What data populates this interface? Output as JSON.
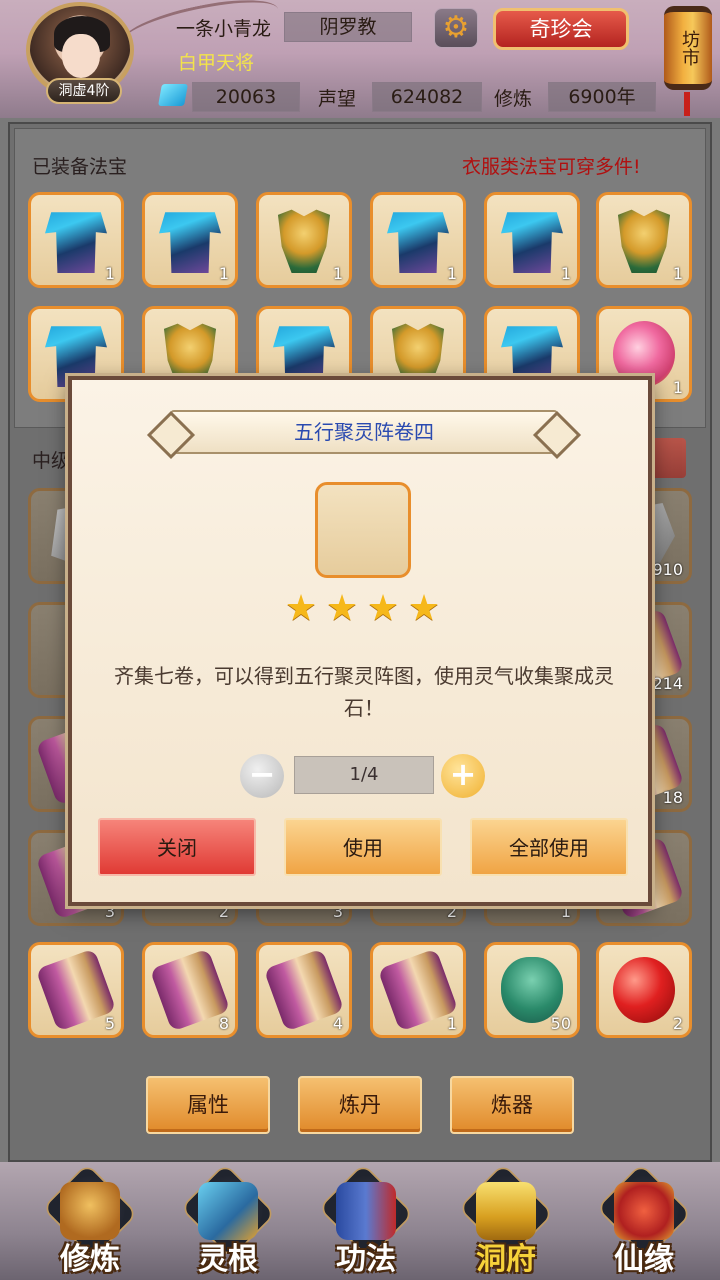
{
  "header": {
    "rank_badge": "洞虚4阶",
    "player_name": "一条小青龙",
    "sect": "阴罗教",
    "title": "白甲天将",
    "gems": "20063",
    "reputation_label": "声望",
    "reputation": "624082",
    "cultivation_label": "修炼",
    "cultivation": "6900年",
    "treasure_button": "奇珍会",
    "market_lantern": "坊市"
  },
  "equipped": {
    "label": "已装备法宝",
    "notice": "衣服类法宝可穿多件!",
    "items": [
      {
        "icon": "blue-robe-icon",
        "count": "1"
      },
      {
        "icon": "blue-robe-icon",
        "count": "1"
      },
      {
        "icon": "gold-armor-icon",
        "count": "1"
      },
      {
        "icon": "blue-robe-icon",
        "count": "1"
      },
      {
        "icon": "blue-robe-icon",
        "count": "1"
      },
      {
        "icon": "gold-armor-icon",
        "count": "1"
      },
      {
        "icon": "blue-robe-icon",
        "count": ""
      },
      {
        "icon": "gold-armor-icon",
        "count": ""
      },
      {
        "icon": "blue-robe-icon",
        "count": ""
      },
      {
        "icon": "gold-armor-icon",
        "count": ""
      },
      {
        "icon": "blue-robe-icon",
        "count": ""
      },
      {
        "icon": "pink-orb-icon",
        "count": "1"
      }
    ]
  },
  "inventory": {
    "label": "中级",
    "visible_counts": [
      "910",
      "214",
      "18",
      "3",
      "2",
      "3",
      "2",
      "1"
    ],
    "last_row": [
      {
        "icon": "scroll-icon",
        "count": "5"
      },
      {
        "icon": "scroll-icon",
        "count": "8"
      },
      {
        "icon": "scroll-icon",
        "count": "4"
      },
      {
        "icon": "scroll-icon",
        "count": "1"
      },
      {
        "icon": "gourd-icon",
        "count": "50"
      },
      {
        "icon": "red-orb-icon",
        "count": "2"
      }
    ]
  },
  "actions": {
    "attributes": "属性",
    "alchemy": "炼丹",
    "forging": "炼器"
  },
  "modal": {
    "title": "五行聚灵阵卷四",
    "item_icon": "scroll-icon",
    "stars": 4,
    "description": "齐集七卷，可以得到五行聚灵阵图，使用灵气收集聚成灵石！",
    "quantity": "1/4",
    "close_label": "关闭",
    "use_label": "使用",
    "use_all_label": "全部使用"
  },
  "nav": {
    "items": [
      {
        "label": "修炼",
        "icon": "meditation-icon"
      },
      {
        "label": "灵根",
        "icon": "sword-icon"
      },
      {
        "label": "功法",
        "icon": "book-icon"
      },
      {
        "label": "洞府",
        "icon": "palace-icon",
        "active": true
      },
      {
        "label": "仙缘",
        "icon": "gourd-icon"
      }
    ]
  },
  "colors": {
    "accent_orange": "#e88e2c",
    "warning_red": "#b01010",
    "title_blue": "#2a4ab0",
    "title_yellow": "#f3e34a"
  }
}
